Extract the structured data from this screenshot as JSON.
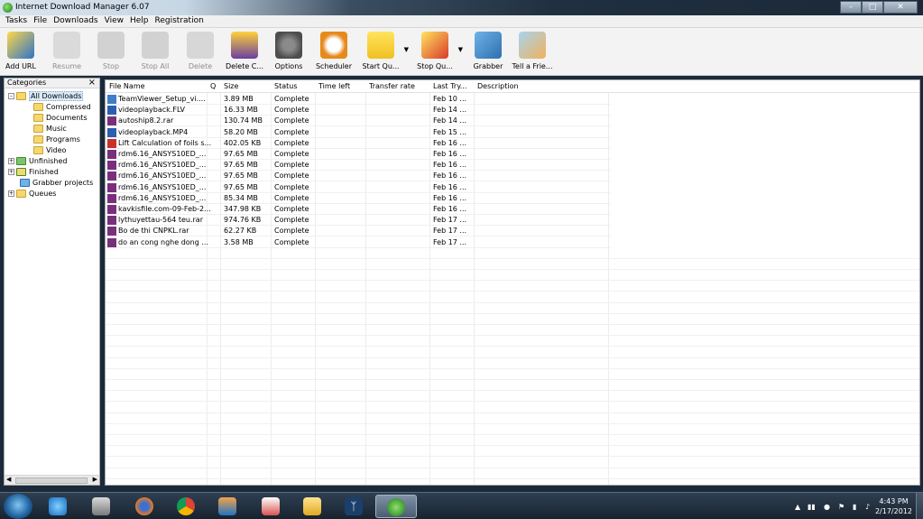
{
  "window": {
    "title": "Internet Download Manager 6.07"
  },
  "menu": [
    "Tasks",
    "File",
    "Downloads",
    "View",
    "Help",
    "Registration"
  ],
  "toolbar": [
    {
      "label": "Add URL",
      "icon": "add-url-icon",
      "enabled": true
    },
    {
      "label": "Resume",
      "icon": "resume-icon",
      "enabled": false
    },
    {
      "label": "Stop",
      "icon": "stop-icon",
      "enabled": false
    },
    {
      "label": "Stop All",
      "icon": "stop-all-icon",
      "enabled": false
    },
    {
      "label": "Delete",
      "icon": "delete-icon",
      "enabled": false
    },
    {
      "label": "Delete C...",
      "icon": "delete-completed-icon",
      "enabled": true
    },
    {
      "label": "Options",
      "icon": "options-gear-icon",
      "enabled": true
    },
    {
      "label": "Scheduler",
      "icon": "scheduler-clock-icon",
      "enabled": true
    },
    {
      "label": "Start Qu...",
      "icon": "start-queue-icon",
      "enabled": true
    },
    {
      "label": "Stop Qu...",
      "icon": "stop-queue-icon",
      "enabled": true
    },
    {
      "label": "Grabber",
      "icon": "grabber-icon",
      "enabled": true
    },
    {
      "label": "Tell a Frie...",
      "icon": "tell-a-friend-icon",
      "enabled": true
    }
  ],
  "categories": {
    "header": "Categories",
    "items": [
      {
        "label": "All Downloads",
        "selected": true
      },
      {
        "label": "Compressed"
      },
      {
        "label": "Documents"
      },
      {
        "label": "Music"
      },
      {
        "label": "Programs"
      },
      {
        "label": "Video"
      },
      {
        "label": "Unfinished"
      },
      {
        "label": "Finished"
      },
      {
        "label": "Grabber projects"
      },
      {
        "label": "Queues"
      }
    ]
  },
  "columns": [
    "File Name",
    "Q",
    "Size",
    "Status",
    "Time left",
    "Transfer rate",
    "Last Try...",
    "Description"
  ],
  "files": [
    {
      "name": "TeamViewer_Setup_vi....",
      "size": "3.89 MB",
      "status": "Complete",
      "last": "Feb 10 ...",
      "icon": "exe-file-icon"
    },
    {
      "name": "videoplayback.FLV",
      "size": "16.33 MB",
      "status": "Complete",
      "last": "Feb 14 ...",
      "icon": "video-file-icon"
    },
    {
      "name": "autoship8.2.rar",
      "size": "130.74 MB",
      "status": "Complete",
      "last": "Feb 14 ...",
      "icon": "rar-file-icon"
    },
    {
      "name": "videoplayback.MP4",
      "size": "58.20 MB",
      "status": "Complete",
      "last": "Feb 15 ...",
      "icon": "video-file-icon"
    },
    {
      "name": "Lift Calculation of foils s...",
      "size": "402.05 KB",
      "status": "Complete",
      "last": "Feb 16 ...",
      "icon": "pdf-file-icon"
    },
    {
      "name": "rdm6.16_ANSYS10ED_...",
      "size": "97.65 MB",
      "status": "Complete",
      "last": "Feb 16 ...",
      "icon": "rar-file-icon"
    },
    {
      "name": "rdm6.16_ANSYS10ED_...",
      "size": "97.65 MB",
      "status": "Complete",
      "last": "Feb 16 ...",
      "icon": "rar-file-icon"
    },
    {
      "name": "rdm6.16_ANSYS10ED_...",
      "size": "97.65 MB",
      "status": "Complete",
      "last": "Feb 16 ...",
      "icon": "rar-file-icon"
    },
    {
      "name": "rdm6.16_ANSYS10ED_...",
      "size": "97.65 MB",
      "status": "Complete",
      "last": "Feb 16 ...",
      "icon": "rar-file-icon"
    },
    {
      "name": "rdm6.16_ANSYS10ED_...",
      "size": "85.34 MB",
      "status": "Complete",
      "last": "Feb 16 ...",
      "icon": "rar-file-icon"
    },
    {
      "name": "kavkisfile.com-09-Feb-2...",
      "size": "347.98 KB",
      "status": "Complete",
      "last": "Feb 16 ...",
      "icon": "rar-file-icon"
    },
    {
      "name": "lythuyettau-564 teu.rar",
      "size": "974.76 KB",
      "status": "Complete",
      "last": "Feb 17 ...",
      "icon": "rar-file-icon"
    },
    {
      "name": "Bo de thi CNPKL.rar",
      "size": "62.27 KB",
      "status": "Complete",
      "last": "Feb 17 ...",
      "icon": "rar-file-icon"
    },
    {
      "name": "do an cong nghe dong ...",
      "size": "3.58 MB",
      "status": "Complete",
      "last": "Feb 17 ...",
      "icon": "rar-file-icon"
    }
  ],
  "taskbar": {
    "apps": [
      "internet-explorer-icon",
      "media-center-icon",
      "firefox-icon",
      "chrome-icon",
      "media-player-icon",
      "foxit-reader-icon",
      "explorer-folder-icon",
      "bluetooth-icon",
      "idm-icon"
    ],
    "clock_time": "4:43 PM",
    "clock_date": "2/17/2012"
  },
  "colors": {
    "accent": "#dbeaf8",
    "title_dark": "#1b2838"
  }
}
